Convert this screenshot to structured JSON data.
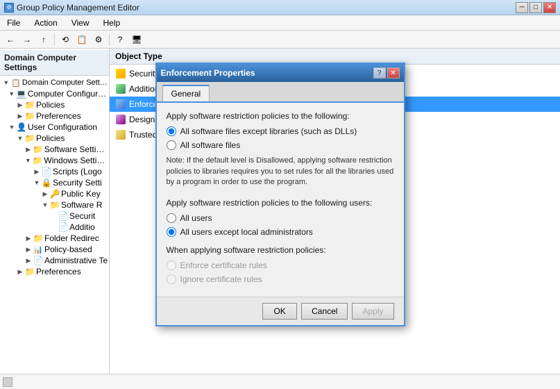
{
  "window": {
    "title": "Group Policy Management Editor",
    "icon": "⚙"
  },
  "titlebar": {
    "controls": [
      "─",
      "□",
      "✕"
    ]
  },
  "menubar": {
    "items": [
      "File",
      "Action",
      "View",
      "Help"
    ]
  },
  "toolbar": {
    "buttons": [
      "←",
      "→",
      "↑",
      "⟲",
      "📋",
      "⚙",
      "?",
      "🖥"
    ]
  },
  "sidebar": {
    "header": "Domain Computer Settings",
    "tree": [
      {
        "level": 0,
        "expand": "▼",
        "icon": "📋",
        "label": "Domain Computer Settings",
        "type": "policy"
      },
      {
        "level": 1,
        "expand": "▼",
        "icon": "💻",
        "label": "Computer Configuratio",
        "type": "computer"
      },
      {
        "level": 2,
        "expand": "▶",
        "icon": "📁",
        "label": "Policies",
        "type": "folder"
      },
      {
        "level": 2,
        "expand": "▶",
        "icon": "📁",
        "label": "Preferences",
        "type": "folder"
      },
      {
        "level": 1,
        "expand": "▼",
        "icon": "👤",
        "label": "User Configuration",
        "type": "user"
      },
      {
        "level": 2,
        "expand": "▼",
        "icon": "📁",
        "label": "Policies",
        "type": "folder"
      },
      {
        "level": 3,
        "expand": "▶",
        "icon": "📁",
        "label": "Software Settings",
        "type": "folder"
      },
      {
        "level": 3,
        "expand": "▼",
        "icon": "📁",
        "label": "Windows Settings",
        "type": "folder"
      },
      {
        "level": 4,
        "expand": "▶",
        "icon": "📄",
        "label": "Scripts (Logo",
        "type": "script"
      },
      {
        "level": 4,
        "expand": "▼",
        "icon": "🔒",
        "label": "Security Setti",
        "type": "security"
      },
      {
        "level": 5,
        "expand": "▶",
        "icon": "🔑",
        "label": "Public Key",
        "type": "key"
      },
      {
        "level": 5,
        "expand": "▼",
        "icon": "📁",
        "label": "Software R",
        "type": "folder"
      },
      {
        "level": 6,
        "expand": " ",
        "icon": "📄",
        "label": "Securit",
        "type": "item"
      },
      {
        "level": 6,
        "expand": " ",
        "icon": "📄",
        "label": "Additio",
        "type": "item"
      },
      {
        "level": 3,
        "expand": "▶",
        "icon": "📁",
        "label": "Folder Redirec",
        "type": "folder"
      },
      {
        "level": 3,
        "expand": "▶",
        "icon": "📊",
        "label": "Policy-based",
        "type": "chart"
      },
      {
        "level": 3,
        "expand": "▶",
        "icon": "📄",
        "label": "Administrative Te",
        "type": "admin"
      },
      {
        "level": 2,
        "expand": "▶",
        "icon": "📁",
        "label": "Preferences",
        "type": "folder"
      }
    ]
  },
  "rightPanel": {
    "header": "Object Type",
    "items": [
      {
        "label": "Security Levels",
        "icon": "security"
      },
      {
        "label": "Additional Rules",
        "icon": "rules"
      },
      {
        "label": "Enforcement",
        "icon": "enforcement",
        "selected": true
      },
      {
        "label": "Designated File Types",
        "icon": "file-types"
      },
      {
        "label": "Trusted Publishers",
        "icon": "trusted"
      }
    ]
  },
  "modal": {
    "title": "Enforcement Properties",
    "helpBtn": "?",
    "closeBtn": "✕",
    "tabs": [
      "General"
    ],
    "activeTab": "General",
    "section1": {
      "label": "Apply software restriction policies to the following:",
      "options": [
        {
          "id": "opt1",
          "label": "All software files except libraries (such as DLLs)",
          "checked": true
        },
        {
          "id": "opt2",
          "label": "All software files",
          "checked": false
        }
      ],
      "note": "Note:  If the default level is Disallowed, applying software restriction policies to libraries requires you to set rules for all the libraries used by a program in order to use the program."
    },
    "section2": {
      "label": "Apply software restriction policies to the following users:",
      "options": [
        {
          "id": "opt3",
          "label": "All users",
          "checked": false
        },
        {
          "id": "opt4",
          "label": "All users except local administrators",
          "checked": true
        }
      ]
    },
    "section3": {
      "label": "When applying software restriction policies:",
      "options": [
        {
          "id": "opt5",
          "label": "Enforce certificate rules",
          "checked": false,
          "disabled": true
        },
        {
          "id": "opt6",
          "label": "Ignore certificate rules",
          "checked": false,
          "disabled": true
        }
      ]
    },
    "footer": {
      "ok": "OK",
      "cancel": "Cancel",
      "apply": "Apply"
    }
  },
  "statusBar": {
    "text": ""
  }
}
